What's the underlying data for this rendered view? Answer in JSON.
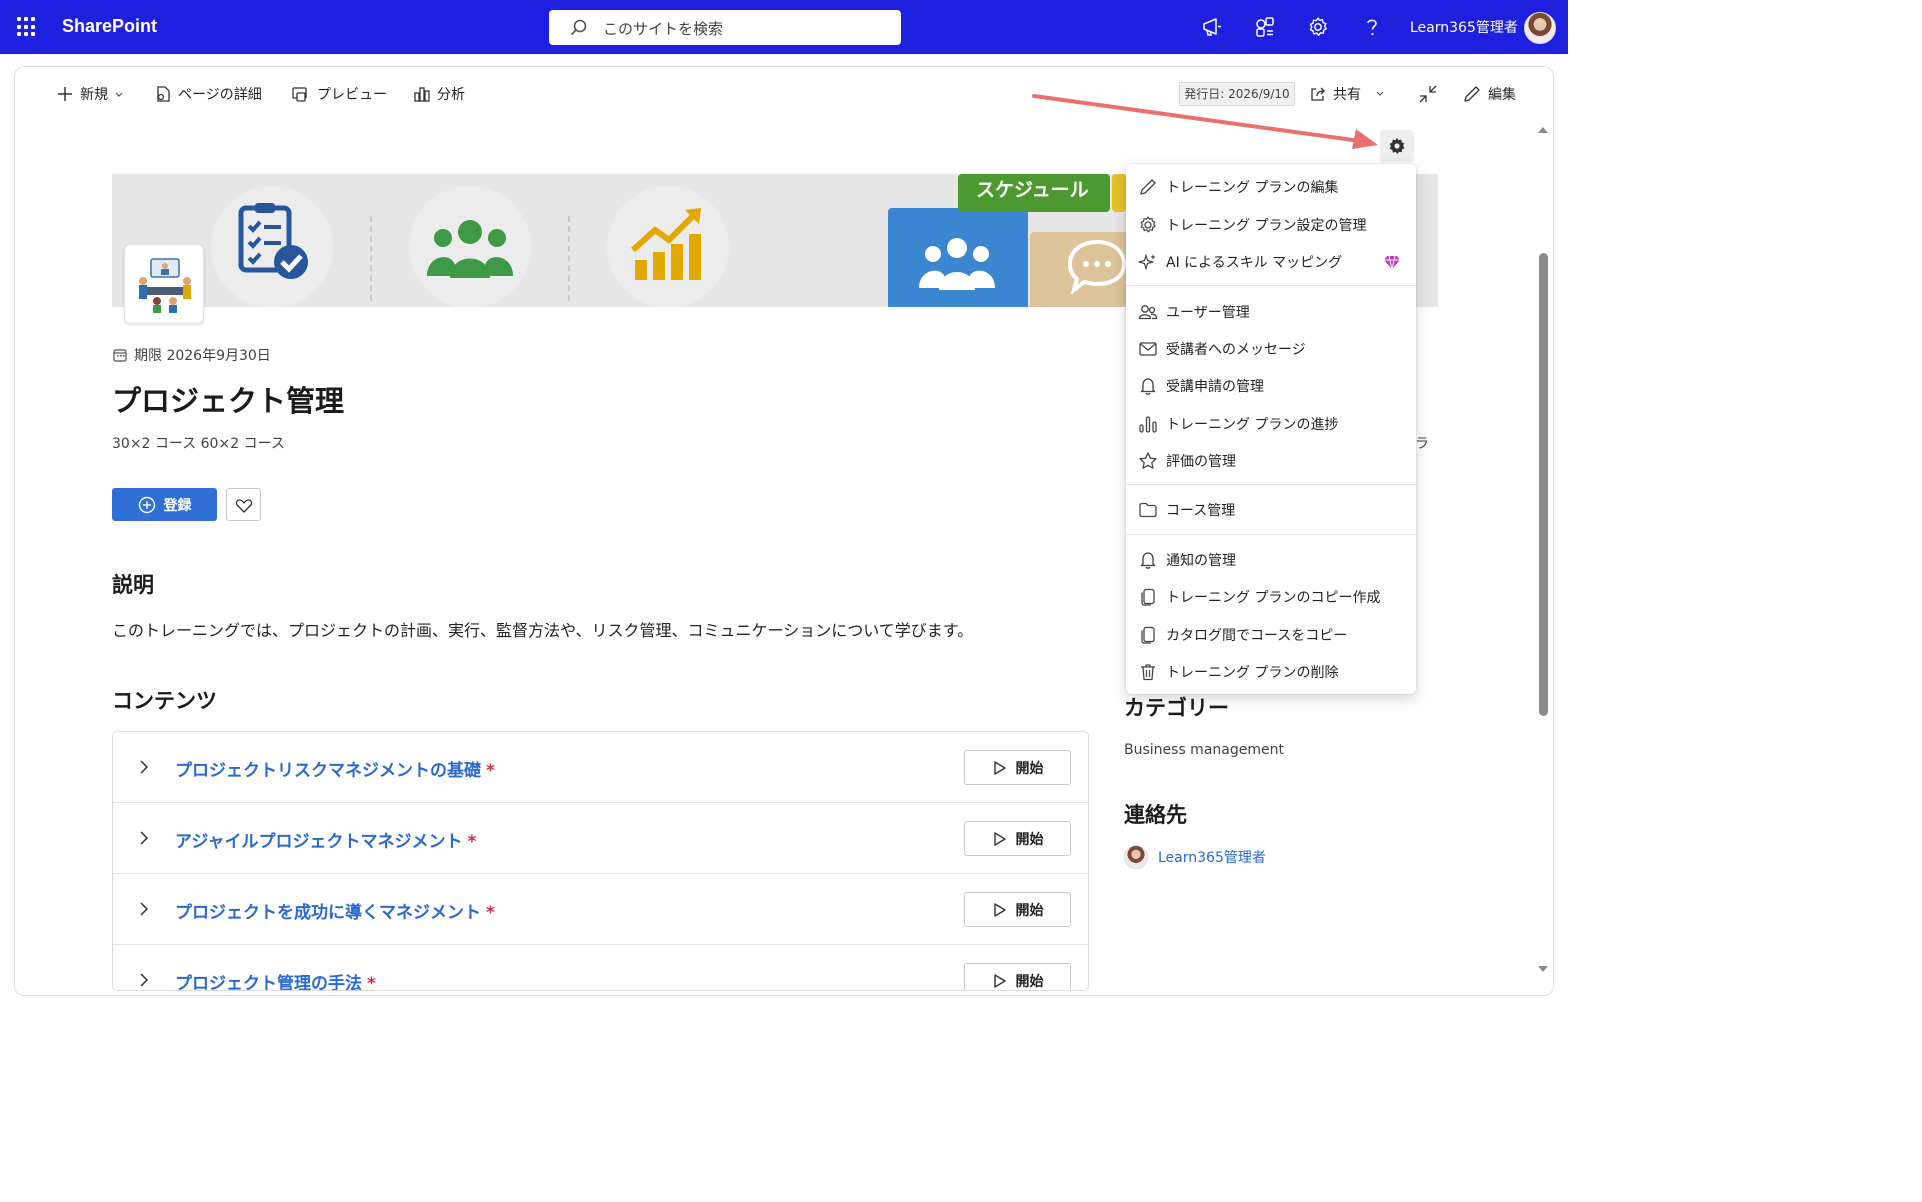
{
  "suitebar": {
    "app_name": "SharePoint",
    "search_placeholder": "このサイトを検索",
    "user_name": "Learn365管理者"
  },
  "commandbar": {
    "new_label": "新規",
    "page_details_label": "ページの詳細",
    "preview_label": "プレビュー",
    "analytics_label": "分析",
    "published_label": "発行日: 2026/9/10",
    "share_label": "共有",
    "edit_label": "編集"
  },
  "banner": {
    "block_text": "スケジュール"
  },
  "course": {
    "deadline": "期限 2026年9月30日",
    "title": "プロジェクト管理",
    "subtitle": "30×2 コース 60×2 コース",
    "enroll_label": "登録",
    "description_heading": "説明",
    "description": "このトレーニングでは、プロジェクトの計画、実行、監督方法や、リスク管理、コミュニケーションについて学びます。",
    "contents_heading": "コンテンツ",
    "required_mark": "*",
    "items": [
      {
        "title": "プロジェクトリスクマネジメントの基礎",
        "start_label": "開始"
      },
      {
        "title": "アジャイルプロジェクトマネジメント",
        "start_label": "開始"
      },
      {
        "title": "プロジェクトを成功に導くマネジメント",
        "start_label": "開始"
      },
      {
        "title": "プロジェクト管理の手法",
        "start_label": "開始"
      }
    ]
  },
  "sidebar": {
    "category_heading": "カテゴリー",
    "category_value": "Business management",
    "contact_heading": "連絡先",
    "contact_name": "Learn365管理者",
    "peek_text": "ラ"
  },
  "menu": {
    "items": [
      {
        "icon": "pencil-icon",
        "label": "トレーニング プランの編集"
      },
      {
        "icon": "gear-icon",
        "label": "トレーニング プラン設定の管理"
      },
      {
        "icon": "sparkle-icon",
        "label": "AI によるスキル マッピング"
      },
      {
        "icon": "users-icon",
        "label": "ユーザー管理"
      },
      {
        "icon": "mail-icon",
        "label": "受講者へのメッセージ"
      },
      {
        "icon": "bell-icon",
        "label": "受講申請の管理"
      },
      {
        "icon": "bar-chart-icon",
        "label": "トレーニング プランの進捗"
      },
      {
        "icon": "star-icon",
        "label": "評価の管理"
      },
      {
        "icon": "folder-icon",
        "label": "コース管理"
      },
      {
        "icon": "bell-icon",
        "label": "通知の管理"
      },
      {
        "icon": "copy-icon",
        "label": "トレーニング プランのコピー作成"
      },
      {
        "icon": "copy-icon",
        "label": "カタログ間でコースをコピー"
      },
      {
        "icon": "trash-icon",
        "label": "トレーニング プランの削除"
      }
    ]
  },
  "colors": {
    "suitebar": "#1f1fe0",
    "accent": "#2f6fd6",
    "link": "#2a6ad0",
    "annotation_arrow": "#e8706f",
    "premium_gem": "#c03ab5"
  }
}
